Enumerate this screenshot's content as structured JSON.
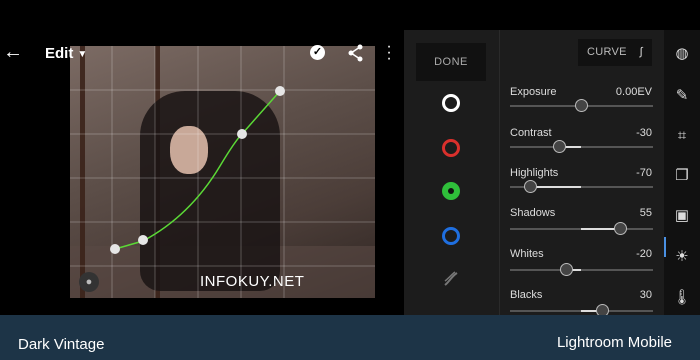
{
  "header": {
    "edit_label": "Edit"
  },
  "photo": {
    "watermark": "INFOKUY.NET"
  },
  "tool_panel": {
    "done_label": "DONE",
    "channels": [
      {
        "name": "luminance",
        "color": "#ffffff"
      },
      {
        "name": "red",
        "color": "#d9302c"
      },
      {
        "name": "green",
        "color": "#2fbf3a",
        "selected": true
      },
      {
        "name": "blue",
        "color": "#1f6fe0"
      }
    ]
  },
  "adjust_panel": {
    "curve_label": "CURVE",
    "rows": [
      {
        "label": "Exposure",
        "value": "0.00EV",
        "position": 0.5
      },
      {
        "label": "Contrast",
        "value": "-30",
        "position": 0.35
      },
      {
        "label": "Highlights",
        "value": "-70",
        "position": 0.15
      },
      {
        "label": "Shadows",
        "value": "55",
        "position": 0.775
      },
      {
        "label": "Whites",
        "value": "-20",
        "position": 0.4
      },
      {
        "label": "Blacks",
        "value": "30",
        "position": 0.65
      }
    ]
  },
  "footer": {
    "left_text": "Dark Vintage",
    "right_text": "Lightroom Mobile"
  },
  "colors": {
    "curve_green": "#5bd936",
    "accent_blue": "#4a90e2",
    "frame_blue": "#1d3447"
  }
}
